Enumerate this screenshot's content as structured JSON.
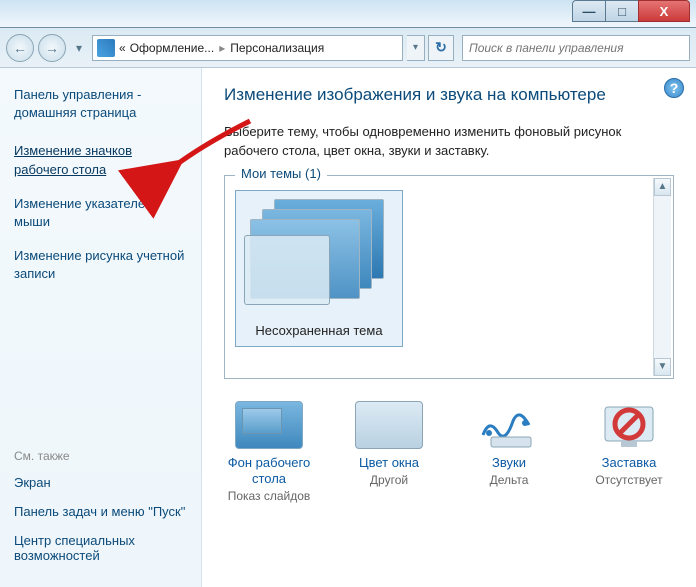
{
  "window": {
    "minimize": "—",
    "maximize": "□",
    "close": "X"
  },
  "nav": {
    "back_glyph": "←",
    "forward_glyph": "→",
    "crumb_prefix": "«",
    "crumb1": "Оформление...",
    "crumb2": "Персонализация",
    "refresh_glyph": "↻",
    "search_placeholder": "Поиск в панели управления"
  },
  "sidebar": {
    "home": "Панель управления - домашняя страница",
    "link_icons": "Изменение значков рабочего стола",
    "link_pointers": "Изменение указателей мыши",
    "link_account_pic": "Изменение рисунка учетной записи",
    "see_also": "См. также",
    "see_display": "Экран",
    "see_taskbar": "Панель задач и меню \"Пуск\"",
    "see_ease": "Центр специальных возможностей"
  },
  "content": {
    "heading": "Изменение изображения и звука на компьютере",
    "desc": "Выберите тему, чтобы одновременно изменить фоновый рисунок рабочего стола, цвет окна, звуки и заставку.",
    "group_legend": "Мои темы (1)",
    "theme_label": "Несохраненная тема"
  },
  "bottom": {
    "wallpaper": {
      "title": "Фон рабочего стола",
      "sub": "Показ слайдов"
    },
    "color": {
      "title": "Цвет окна",
      "sub": "Другой"
    },
    "sounds": {
      "title": "Звуки",
      "sub": "Дельта"
    },
    "saver": {
      "title": "Заставка",
      "sub": "Отсутствует"
    }
  }
}
